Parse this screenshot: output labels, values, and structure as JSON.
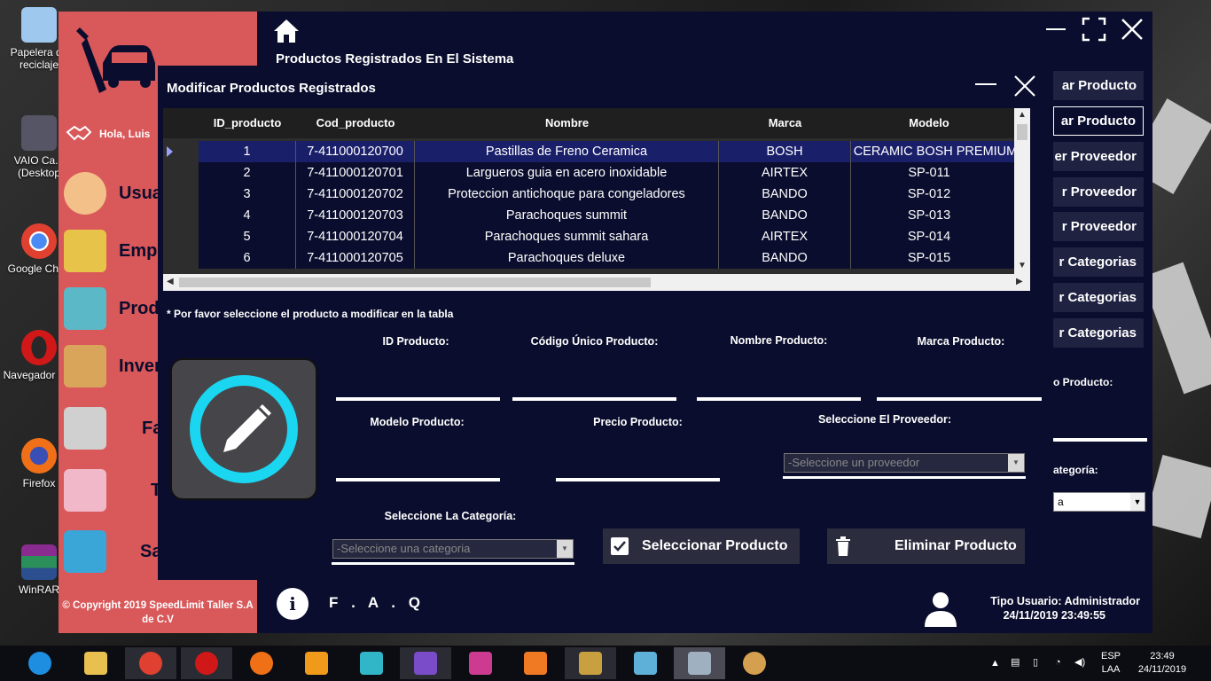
{
  "desktop": {
    "icons": [
      {
        "label": "Papelera de reciclaje",
        "color": "#9ec8ee"
      },
      {
        "label": "VAIO Ca... (Desktop",
        "color": "#556"
      },
      {
        "label": "Google Chr...",
        "color": "#e04030"
      },
      {
        "label": "Navegador C...",
        "color": "#d01818"
      },
      {
        "label": "Firefox",
        "color": "#f07018"
      },
      {
        "label": "WinRAR",
        "color": "#8a2b8f"
      }
    ]
  },
  "app": {
    "title": "Productos Registrados En El Sistema",
    "greeting": "Hola, Luis",
    "sidebar": [
      {
        "label": "Usua",
        "icon": "user-icon",
        "color": "#f3c089"
      },
      {
        "label": "Emple",
        "icon": "employee-badge-icon",
        "color": "#e8c34a"
      },
      {
        "label": "Produ",
        "icon": "shopping-basket-icon",
        "color": "#5bb9c7"
      },
      {
        "label": "Inven",
        "icon": "box-icon",
        "color": "#d9a55a"
      },
      {
        "label": "Factu",
        "icon": "cash-register-icon",
        "color": "#d0d0d0"
      },
      {
        "label": "Tien",
        "icon": "store-icon",
        "color": "#f0b8c8"
      },
      {
        "label": "Sa",
        "icon": "exit-icon",
        "color": "#3aa6d8"
      }
    ],
    "copyright": "© Copyright 2019 SpeedLimit Taller S.A de C.V",
    "right_buttons": [
      "ar Producto",
      "ar Producto",
      "er Proveedor",
      "r Proveedor",
      "r Proveedor",
      "r Categorias",
      "r Categorias",
      "r Categorias"
    ],
    "right_label_producto": "o Producto:",
    "right_label_categoria": "ategoría:",
    "right_combo_value": "a",
    "faq": "F . A . Q",
    "user_type": "Tipo Usuario: Administrador",
    "datetime": "24/11/2019 23:49:55"
  },
  "modal": {
    "title": "Modificar Productos Registrados",
    "columns": [
      "ID_producto",
      "Cod_producto",
      "Nombre",
      "Marca",
      "Modelo"
    ],
    "rows": [
      [
        "1",
        "7-411000120700",
        "Pastillas de Freno Ceramica",
        "BOSH",
        "CERAMIC BOSH PREMIUM"
      ],
      [
        "2",
        "7-411000120701",
        "Largueros guia en acero inoxidable",
        "AIRTEX",
        "SP-011"
      ],
      [
        "3",
        "7-411000120702",
        "Proteccion antichoque para congeladores",
        "BANDO",
        "SP-012"
      ],
      [
        "4",
        "7-411000120703",
        "Parachoques summit",
        "BANDO",
        "SP-013"
      ],
      [
        "5",
        "7-411000120704",
        "Parachoques summit sahara",
        "AIRTEX",
        "SP-014"
      ],
      [
        "6",
        "7-411000120705",
        "Parachoques deluxe",
        "BANDO",
        "SP-015"
      ]
    ],
    "hint": "* Por favor seleccione el producto a modificar en la tabla",
    "labels": {
      "id": "ID Producto:",
      "codigo": "Código Único Producto:",
      "nombre": "Nombre Producto:",
      "marca": "Marca Producto:",
      "modelo": "Modelo Producto:",
      "precio": "Precio Producto:",
      "proveedor": "Seleccione El Proveedor:",
      "categoria": "Seleccione La Categoría:"
    },
    "proveedor_placeholder": "-Seleccione un proveedor",
    "categoria_placeholder": "-Seleccione una categoria",
    "btn_select": "Seleccionar Producto",
    "btn_delete": "Eliminar Producto"
  },
  "taskbar": {
    "apps": [
      {
        "name": "ie-icon",
        "color": "#1e8fe0"
      },
      {
        "name": "file-explorer-icon",
        "color": "#e8c050"
      },
      {
        "name": "chrome-icon",
        "color": "#e04030"
      },
      {
        "name": "opera-icon",
        "color": "#d01818"
      },
      {
        "name": "firefox-icon",
        "color": "#f07018"
      },
      {
        "name": "sublime-icon",
        "color": "#f09a1c"
      },
      {
        "name": "powershell-icon",
        "color": "#31b6c8"
      },
      {
        "name": "visual-studio-icon",
        "color": "#7b4cc9"
      },
      {
        "name": "app-icon",
        "color": "#cc3b8f"
      },
      {
        "name": "xampp-icon",
        "color": "#f07a24"
      },
      {
        "name": "tools-icon",
        "color": "#c8a040"
      },
      {
        "name": "package-icon",
        "color": "#5fb0d8"
      },
      {
        "name": "wrench-icon",
        "color": "#9fb0c0"
      },
      {
        "name": "paint-icon",
        "color": "#d4a050"
      }
    ],
    "lang": "ESP",
    "region": "LAA",
    "time": "23:49",
    "date": "24/11/2019"
  }
}
